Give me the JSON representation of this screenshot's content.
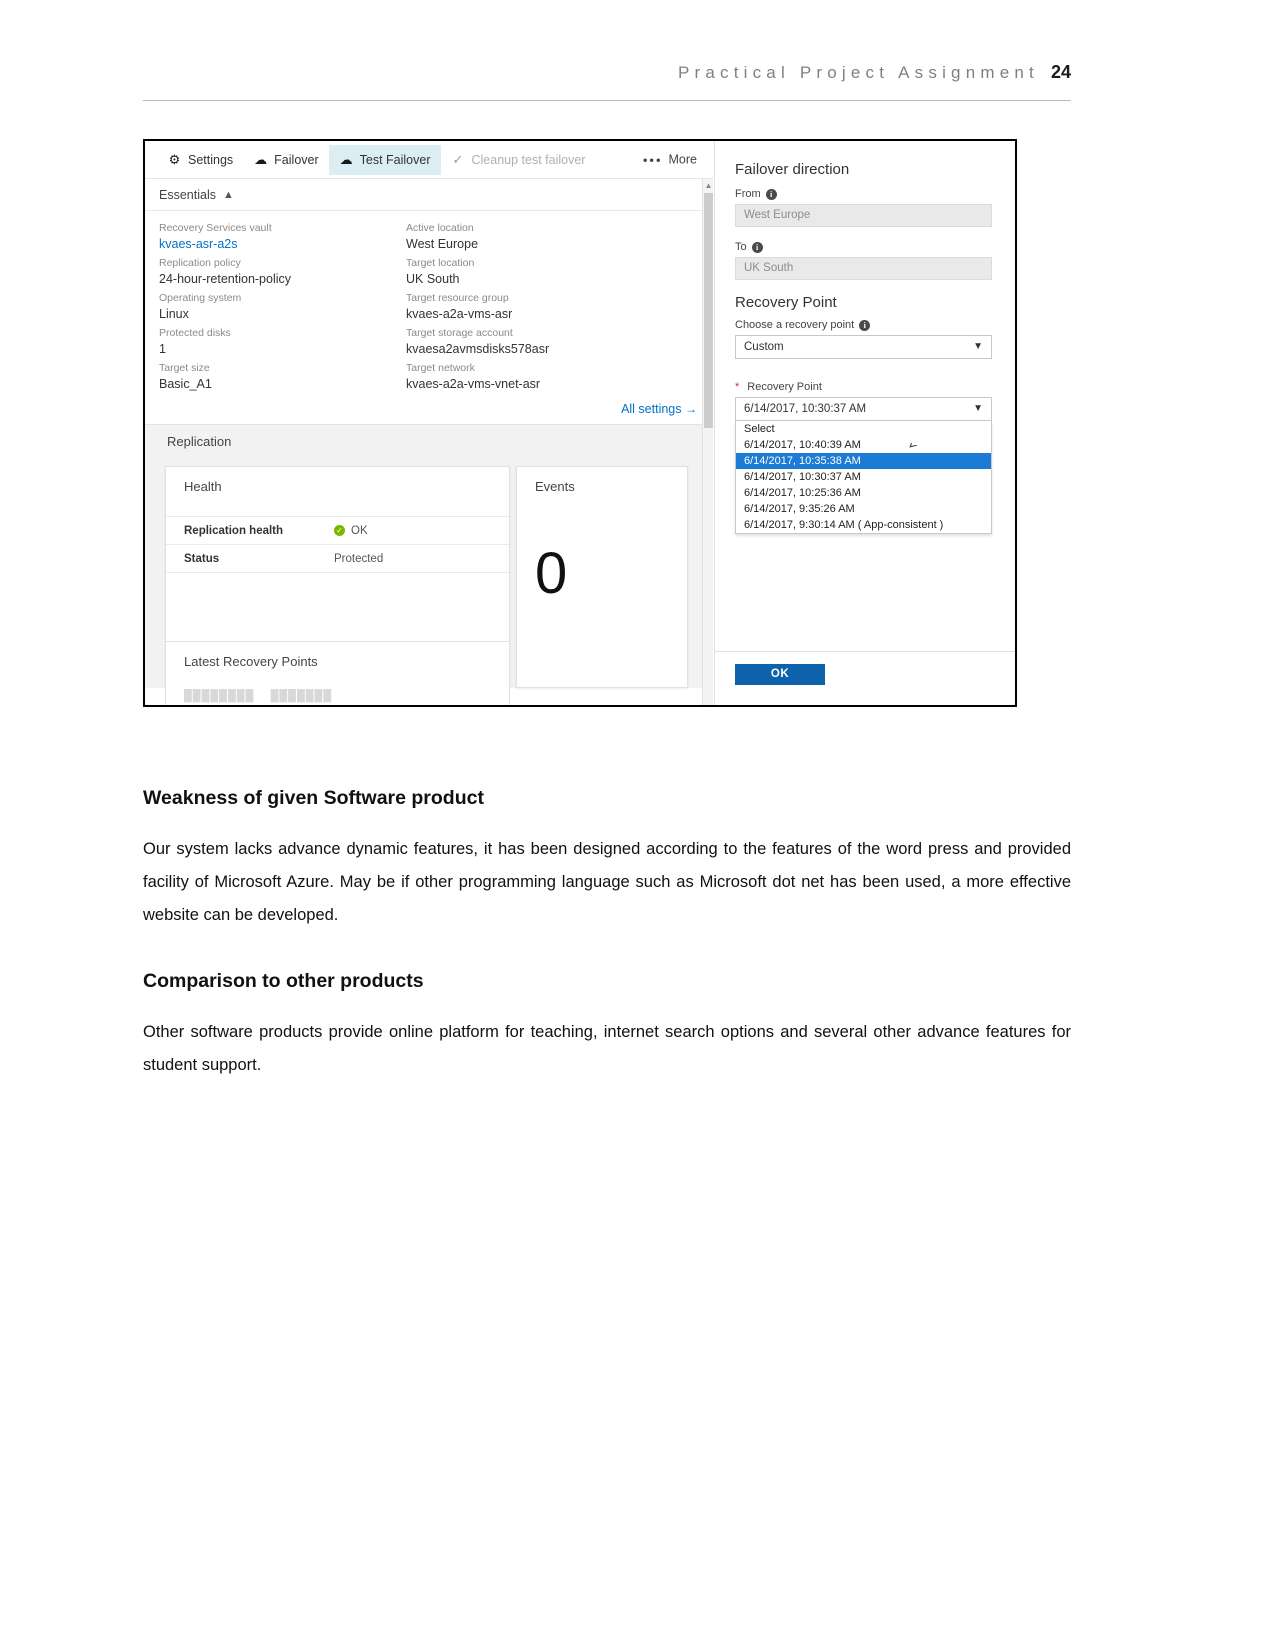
{
  "header": {
    "title": "Practical Project Assignment",
    "page_number": "24"
  },
  "azure_screenshot": {
    "toolbar": {
      "settings_label": "Settings",
      "failover_label": "Failover",
      "test_failover_label": "Test Failover",
      "cleanup_label": "Cleanup test failover",
      "more_label": "More"
    },
    "essentials": {
      "section_label": "Essentials",
      "left_column": [
        {
          "key": "Recovery Services vault",
          "value": "kvaes-asr-a2s",
          "is_link": true
        },
        {
          "key": "Replication policy",
          "value": "24-hour-retention-policy",
          "is_link": false
        },
        {
          "key": "Operating system",
          "value": "Linux",
          "is_link": false
        },
        {
          "key": "Protected disks",
          "value": "1",
          "is_link": false
        },
        {
          "key": "Target size",
          "value": "Basic_A1",
          "is_link": false
        }
      ],
      "right_column": [
        {
          "key": "Active location",
          "value": "West Europe"
        },
        {
          "key": "Target location",
          "value": "UK South"
        },
        {
          "key": "Target resource group",
          "value": "kvaes-a2a-vms-asr"
        },
        {
          "key": "Target storage account",
          "value": "kvaesa2avmsdisks578asr"
        },
        {
          "key": "Target network",
          "value": "kvaes-a2a-vms-vnet-asr"
        }
      ],
      "all_settings_label": "All settings",
      "all_settings_arrow": "→"
    },
    "replication": {
      "section_label": "Replication",
      "health_tile_title": "Health",
      "rows": [
        {
          "key": "Replication health",
          "value": "OK"
        },
        {
          "key": "Status",
          "value": "Protected"
        }
      ],
      "events_tile_title": "Events",
      "events_count": "0",
      "latest_recovery_points_title": "Latest Recovery Points"
    },
    "failover_panel": {
      "direction_heading": "Failover direction",
      "from_label": "From",
      "from_value": "West Europe",
      "to_label": "To",
      "to_value": "UK South",
      "recovery_point_heading": "Recovery Point",
      "choose_label": "Choose a recovery point",
      "choose_value": "Custom",
      "required_marker": "*",
      "recovery_point_label": "Recovery Point",
      "selected_recovery_point": "6/14/2017, 10:30:37 AM",
      "dropdown_options": [
        "Select",
        "6/14/2017, 10:40:39 AM",
        "6/14/2017, 10:35:38 AM",
        "6/14/2017, 10:30:37 AM",
        "6/14/2017, 10:25:36 AM",
        "6/14/2017, 9:35:26 AM",
        "6/14/2017, 9:30:14 AM ( App-consistent )"
      ],
      "highlighted_option_index": 2,
      "ok_button_label": "OK"
    },
    "colors": {
      "accent_blue": "#0072c6",
      "highlight_blue": "#1c7bd4",
      "ok_button_blue": "#0d62ab",
      "health_green": "#7ab800",
      "active_tab_bg": "#daeef3"
    }
  },
  "document": {
    "sections": [
      {
        "heading": "Weakness of given Software product",
        "paragraph": "Our system lacks advance dynamic features, it has been designed according to the features of the word press and provided facility of Microsoft Azure. May be if other programming language such as Microsoft dot net has been used, a more effective website can be developed."
      },
      {
        "heading": "Comparison to other products",
        "paragraph": "Other software products provide online platform for teaching, internet search options and several other advance features for student support."
      }
    ]
  }
}
